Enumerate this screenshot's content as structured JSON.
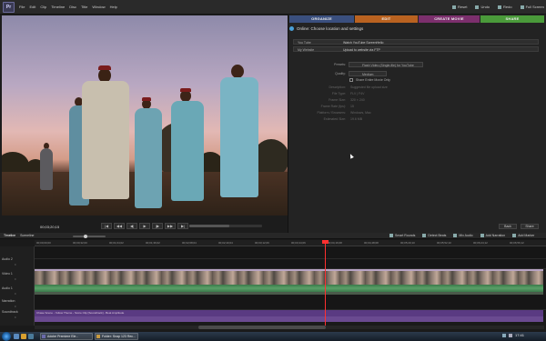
{
  "menubar": {
    "logo": "Pr",
    "menus": [
      "File",
      "Edit",
      "Clip",
      "Timeline",
      "Disc",
      "Title",
      "Window",
      "Help"
    ],
    "right": [
      "Reset",
      "Undo",
      "Redo",
      "Full Screen"
    ]
  },
  "monitor": {
    "timecode": "00;03;20;15",
    "transport": [
      "|◀",
      "◀◀",
      "◀|",
      "▶",
      "|▶",
      "▶▶",
      "▶|"
    ]
  },
  "tabs": {
    "organize": "ORGANIZE",
    "edit": "EDIT",
    "create": "CREATE MOVIE",
    "share": "SHARE"
  },
  "share": {
    "header": "Online: Choose location and settings",
    "fields": [
      {
        "label": "You Tube",
        "value": "Watch YouTube ScreenHello"
      },
      {
        "label": "My Website",
        "value": "Upload to website via FTP"
      }
    ],
    "form": [
      {
        "label": "Presets:",
        "value": "Flash Video (Single-file) for YouTube"
      },
      {
        "label": "Quality:",
        "value": "Medium"
      },
      {
        "label": "",
        "value": "Share Entire Movie Only"
      }
    ],
    "info": [
      {
        "label": "Description:",
        "value": "Suggested file upload size"
      },
      {
        "label": "File Type:",
        "value": "FLV | F4V"
      },
      {
        "label": "Frame Size:",
        "value": "320 × 240"
      },
      {
        "label": "Frame Rate (fps):",
        "value": "15"
      },
      {
        "label": "Platform / Browsers:",
        "value": "Windows, Mac"
      },
      {
        "label": "Estimated Size:",
        "value": "19.6 MB"
      }
    ],
    "back": "Back",
    "share_btn": "Share"
  },
  "timeline": {
    "tabs": [
      "Timeline",
      "Sceneline"
    ],
    "right_tools": [
      "Smart Rounds",
      "Detect Beats",
      "Mix Audio",
      "Add Narration",
      "Add Marker"
    ],
    "ticks": [
      "00;00;00;00",
      "00;00;32;00",
      "00;01;04;02",
      "00;01;36;02",
      "00;02;08;04",
      "00;02;40;04",
      "00;03;12;06",
      "00;03;44;06",
      "00;04;16;08",
      "00;04;48;08",
      "00;05;20;10",
      "00;05;52;10",
      "00;06;24;12",
      "00;06;56;12"
    ],
    "tracks": [
      {
        "label": "Audio 2",
        "sub": "≡"
      },
      {
        "label": "Video 1",
        "sub": "≡"
      },
      {
        "label": "Audio 1",
        "sub": "≡"
      },
      {
        "label": "Narration",
        "sub": "≡"
      },
      {
        "label": "Soundtrack",
        "sub": "≡"
      }
    ],
    "soundtrack_clip": "Chase Scene - Yellow Theme - Score Clip [Soundtrack] - Beat Amplitude"
  },
  "taskbar": {
    "items": [
      "Adobe Premiere Ele...",
      "Folder: Snap 123 Rec..."
    ],
    "clock": "17:41"
  },
  "colors": {
    "organize": "#3a4f7e",
    "edit": "#b96220",
    "create": "#7c2f6d",
    "share": "#4a9a3a",
    "playhead": "#ff3030"
  }
}
